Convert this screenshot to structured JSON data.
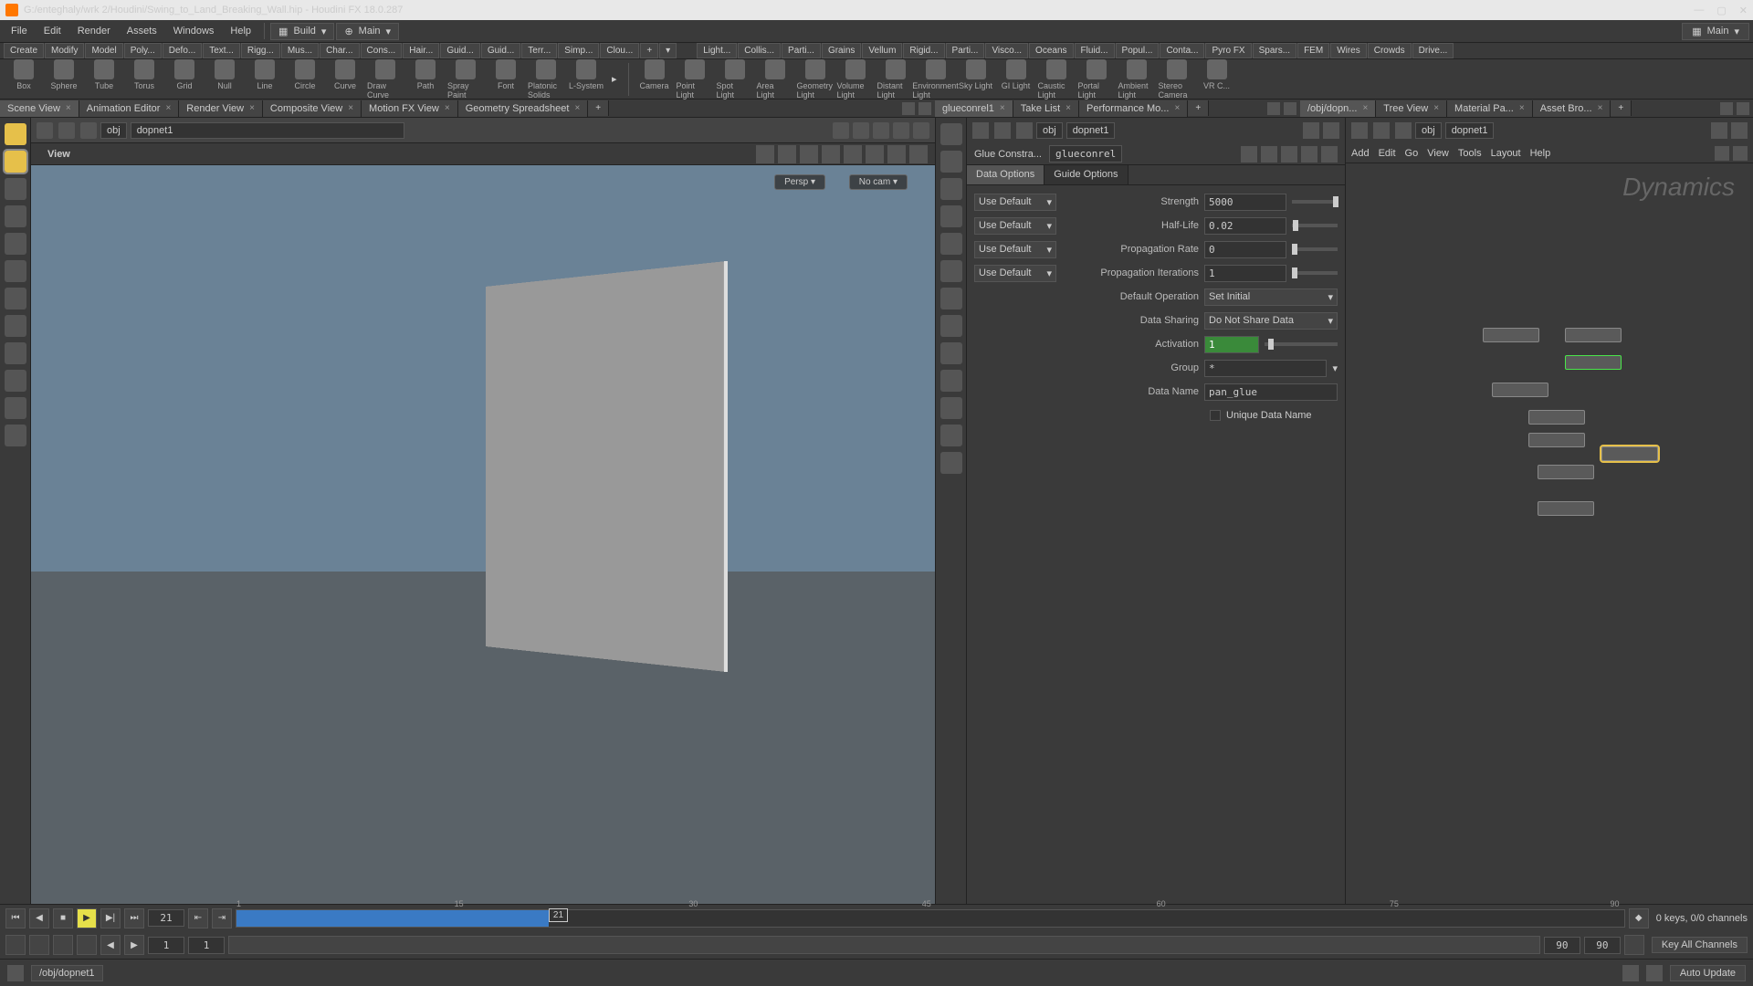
{
  "titlebar": {
    "text": "G:/enteghaly/wrk 2/Houdini/Swing_to_Land_Breaking_Wall.hip - Houdini FX 18.0.287"
  },
  "menus": [
    "File",
    "Edit",
    "Render",
    "Assets",
    "Windows",
    "Help"
  ],
  "desktops": {
    "build": "Build",
    "main": "Main",
    "main2": "Main"
  },
  "shelf_tabs_left": [
    "Create",
    "Modify",
    "Model",
    "Poly...",
    "Defo...",
    "Text...",
    "Rigg...",
    "Mus...",
    "Char...",
    "Cons...",
    "Hair...",
    "Guid...",
    "Guid...",
    "Terr...",
    "Simp...",
    "Clou..."
  ],
  "shelf_tabs_right": [
    "Light...",
    "Collis...",
    "Parti...",
    "Grains",
    "Vellum",
    "Rigid...",
    "Parti...",
    "Visco...",
    "Oceans",
    "Fluid...",
    "Popul...",
    "Conta...",
    "Pyro FX",
    "Spars...",
    "FEM",
    "Wires",
    "Crowds",
    "Drive..."
  ],
  "shelf_tools": [
    "Box",
    "Sphere",
    "Tube",
    "Torus",
    "Grid",
    "Null",
    "Line",
    "Circle",
    "Curve",
    "Draw Curve",
    "Path",
    "Spray Paint",
    "Font",
    "Platonic Solids",
    "L-System"
  ],
  "shelf_tools_right": [
    "Camera",
    "Point Light",
    "Spot Light",
    "Area Light",
    "Geometry Light",
    "Volume Light",
    "Distant Light",
    "Environment Light",
    "Sky Light",
    "GI Light",
    "Caustic Light",
    "Portal Light",
    "Ambient Light",
    "Stereo Camera",
    "VR C..."
  ],
  "panetabs_left": [
    "Scene View",
    "Animation Editor",
    "Render View",
    "Composite View",
    "Motion FX View",
    "Geometry Spreadsheet"
  ],
  "panetabs_mid": [
    "glueconrel1",
    "Take List",
    "Performance Mo..."
  ],
  "panetabs_right": [
    "/obj/dopn...",
    "Tree View",
    "Material Pa...",
    "Asset Bro..."
  ],
  "viewport": {
    "path": {
      "ctx": "obj",
      "node": "dopnet1"
    },
    "label": "View",
    "badges": {
      "persp": "Persp ▾",
      "cam": "No cam ▾"
    }
  },
  "parm": {
    "path": {
      "ctx": "obj",
      "node": "dopnet1"
    },
    "title": "Glue Constra...",
    "name": "glueconrel",
    "tabs": [
      "Data Options",
      "Guide Options"
    ],
    "usedef": "Use Default",
    "rows": {
      "strength": {
        "label": "Strength",
        "val": "5000"
      },
      "halflife": {
        "label": "Half-Life",
        "val": "0.02"
      },
      "proprate": {
        "label": "Propagation Rate",
        "val": "0"
      },
      "propiter": {
        "label": "Propagation Iterations",
        "val": "1"
      },
      "defop": {
        "label": "Default Operation",
        "val": "Set Initial"
      },
      "datashare": {
        "label": "Data Sharing",
        "val": "Do Not Share Data"
      },
      "activation": {
        "label": "Activation",
        "val": "1"
      },
      "group": {
        "label": "Group",
        "val": "*"
      },
      "dataname": {
        "label": "Data Name",
        "val": "pan_glue"
      },
      "unique": {
        "label": "Unique Data Name"
      }
    }
  },
  "network": {
    "path": {
      "ctx": "obj",
      "node": "dopnet1"
    },
    "menus": [
      "Add",
      "Edit",
      "Go",
      "View",
      "Tools",
      "Layout",
      "Help"
    ],
    "stamp": "Dynamics"
  },
  "timeline": {
    "frame": "21",
    "start": "1",
    "rstart": "1",
    "end": "90",
    "rend": "90",
    "ticks": [
      "1",
      "15",
      "30",
      "45",
      "60",
      "75",
      "90"
    ],
    "keys": "0 keys, 0/0 channels",
    "keyall": "Key All Channels"
  },
  "status": {
    "path": "/obj/dopnet1",
    "update": "Auto Update"
  }
}
